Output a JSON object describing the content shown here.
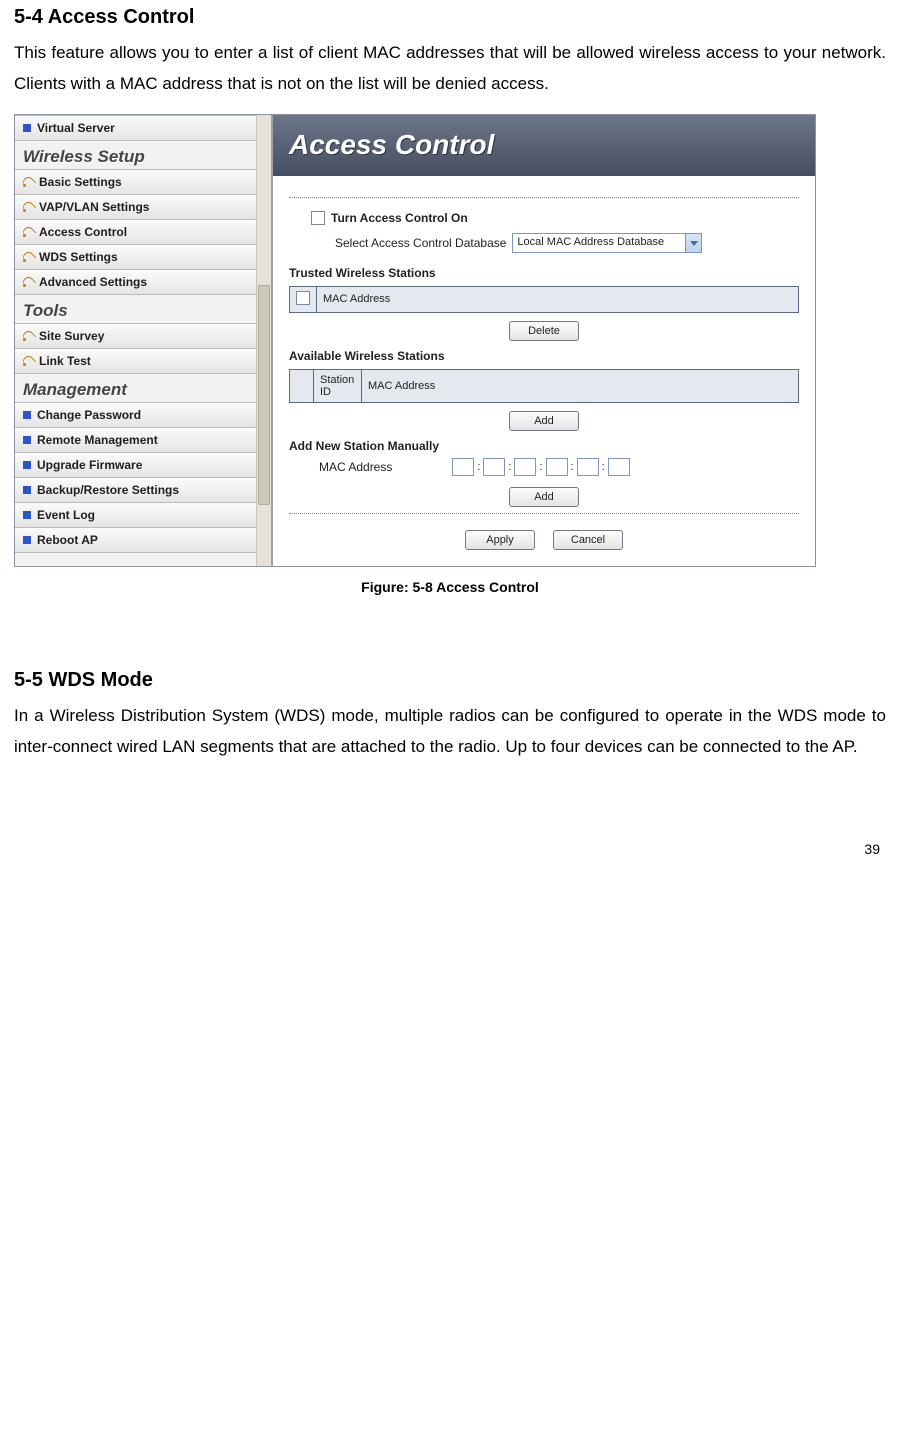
{
  "section54": {
    "heading": "5-4  Access Control",
    "body": "This feature allows you to enter a list of client MAC addresses that will be allowed wireless access to your network.   Clients with a MAC address that is not on the list will be denied access."
  },
  "sidebar": {
    "items": [
      {
        "label": "Virtual Server",
        "icon": "blue"
      }
    ],
    "group_wireless": "Wireless Setup",
    "wireless_items": [
      {
        "label": "Basic Settings",
        "icon": "wifi"
      },
      {
        "label": "VAP/VLAN Settings",
        "icon": "wifi"
      },
      {
        "label": "Access Control",
        "icon": "wifi"
      },
      {
        "label": "WDS Settings",
        "icon": "wifi"
      },
      {
        "label": "Advanced Settings",
        "icon": "wifi"
      }
    ],
    "group_tools": "Tools",
    "tools_items": [
      {
        "label": "Site Survey",
        "icon": "wifi"
      },
      {
        "label": "Link Test",
        "icon": "wifi"
      }
    ],
    "group_management": "Management",
    "management_items": [
      {
        "label": "Change Password",
        "icon": "blue"
      },
      {
        "label": "Remote Management",
        "icon": "blue"
      },
      {
        "label": "Upgrade Firmware",
        "icon": "blue"
      },
      {
        "label": "Backup/Restore Settings",
        "icon": "blue"
      },
      {
        "label": "Event Log",
        "icon": "blue"
      },
      {
        "label": "Reboot AP",
        "icon": "blue"
      }
    ]
  },
  "panel": {
    "title": "Access Control",
    "turn_on_label": "Turn Access Control On",
    "select_db_label": "Select Access Control Database",
    "select_db_value": "Local MAC Address Database",
    "trusted_heading": "Trusted Wireless Stations",
    "col_mac": "MAC Address",
    "btn_delete": "Delete",
    "available_heading": "Available Wireless Stations",
    "col_station_id": "Station ID",
    "btn_add": "Add",
    "manual_heading": "Add New Station Manually",
    "mac_label": "MAC Address",
    "btn_add2": "Add",
    "btn_apply": "Apply",
    "btn_cancel": "Cancel"
  },
  "figure_caption": "Figure: 5-8 Access Control",
  "section55": {
    "heading": "5-5  WDS Mode",
    "body": "In a Wireless Distribution System (WDS) mode, multiple radios can be configured to operate in the WDS mode to inter-connect wired LAN segments that are attached to the radio. Up to four devices can be connected to the AP."
  },
  "page_number": "39"
}
